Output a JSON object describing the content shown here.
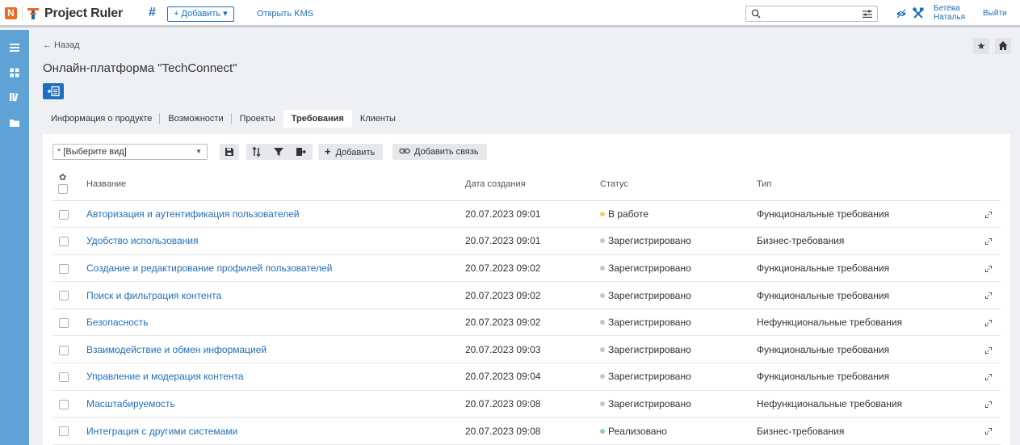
{
  "header": {
    "logo_letter": "N",
    "app_title": "Project Ruler",
    "add_label": "+ Добавить ▾",
    "kms_label": "Открыть KMS",
    "search_placeholder": "",
    "user_name": "Бетёва Наталья",
    "logout_label": "Выйти"
  },
  "page": {
    "back_label": "← Назад",
    "title": "Онлайн-платформа \"TechConnect\""
  },
  "tabs": [
    {
      "label": "Информация о продукте",
      "active": false
    },
    {
      "label": "Возможности",
      "active": false
    },
    {
      "label": "Проекты",
      "active": false
    },
    {
      "label": "Требования",
      "active": true
    },
    {
      "label": "Клиенты",
      "active": false
    }
  ],
  "toolbar": {
    "view_required_mark": "*",
    "view_select_value": "[Выберите вид]",
    "add_label": "Добавить",
    "add_link_label": "Добавить связь"
  },
  "table": {
    "columns": [
      "Название",
      "Дата создания",
      "Статус",
      "Тип"
    ],
    "rows": [
      {
        "name": "Авторизация и аутентификация пользователей",
        "date": "20.07.2023 09:01",
        "status": "В работе",
        "status_color": "#f2cf6b",
        "type": "Функциональные требования"
      },
      {
        "name": "Удобство использования",
        "date": "20.07.2023 09:01",
        "status": "Зарегистрировано",
        "status_color": "#c4c7cb",
        "type": "Бизнес-требования"
      },
      {
        "name": "Создание и редактирование профилей пользователей",
        "date": "20.07.2023 09:02",
        "status": "Зарегистрировано",
        "status_color": "#c4c7cb",
        "type": "Функциональные требования"
      },
      {
        "name": "Поиск и фильтрация контента",
        "date": "20.07.2023 09:02",
        "status": "Зарегистрировано",
        "status_color": "#c4c7cb",
        "type": "Функциональные требования"
      },
      {
        "name": "Безопасность",
        "date": "20.07.2023 09:02",
        "status": "Зарегистрировано",
        "status_color": "#c4c7cb",
        "type": "Нефункциональные требования"
      },
      {
        "name": "Взаимодействие и обмен информацией",
        "date": "20.07.2023 09:03",
        "status": "Зарегистрировано",
        "status_color": "#c4c7cb",
        "type": "Функциональные требования"
      },
      {
        "name": "Управление и модерация контента",
        "date": "20.07.2023 09:04",
        "status": "Зарегистрировано",
        "status_color": "#c4c7cb",
        "type": "Функциональные требования"
      },
      {
        "name": "Масштабируемость",
        "date": "20.07.2023 09:08",
        "status": "Зарегистрировано",
        "status_color": "#c4c7cb",
        "type": "Нефункциональные требования"
      },
      {
        "name": "Интеграция с другими системами",
        "date": "20.07.2023 09:08",
        "status": "Реализовано",
        "status_color": "#8fd6a0",
        "type": "Бизнес-требования"
      }
    ]
  },
  "colors": {
    "accent": "#1f6fc0",
    "sidebar": "#5fa2d6",
    "logo_orange": "#f26a21"
  },
  "icons": {
    "sidebar": [
      "menu-icon",
      "dashboard-icon",
      "library-icon",
      "folder-icon"
    ],
    "toolbar": [
      "save-icon",
      "sort-icon",
      "filter-icon",
      "export-icon",
      "plus-icon",
      "link-icon"
    ],
    "row": "unlink-icon"
  }
}
